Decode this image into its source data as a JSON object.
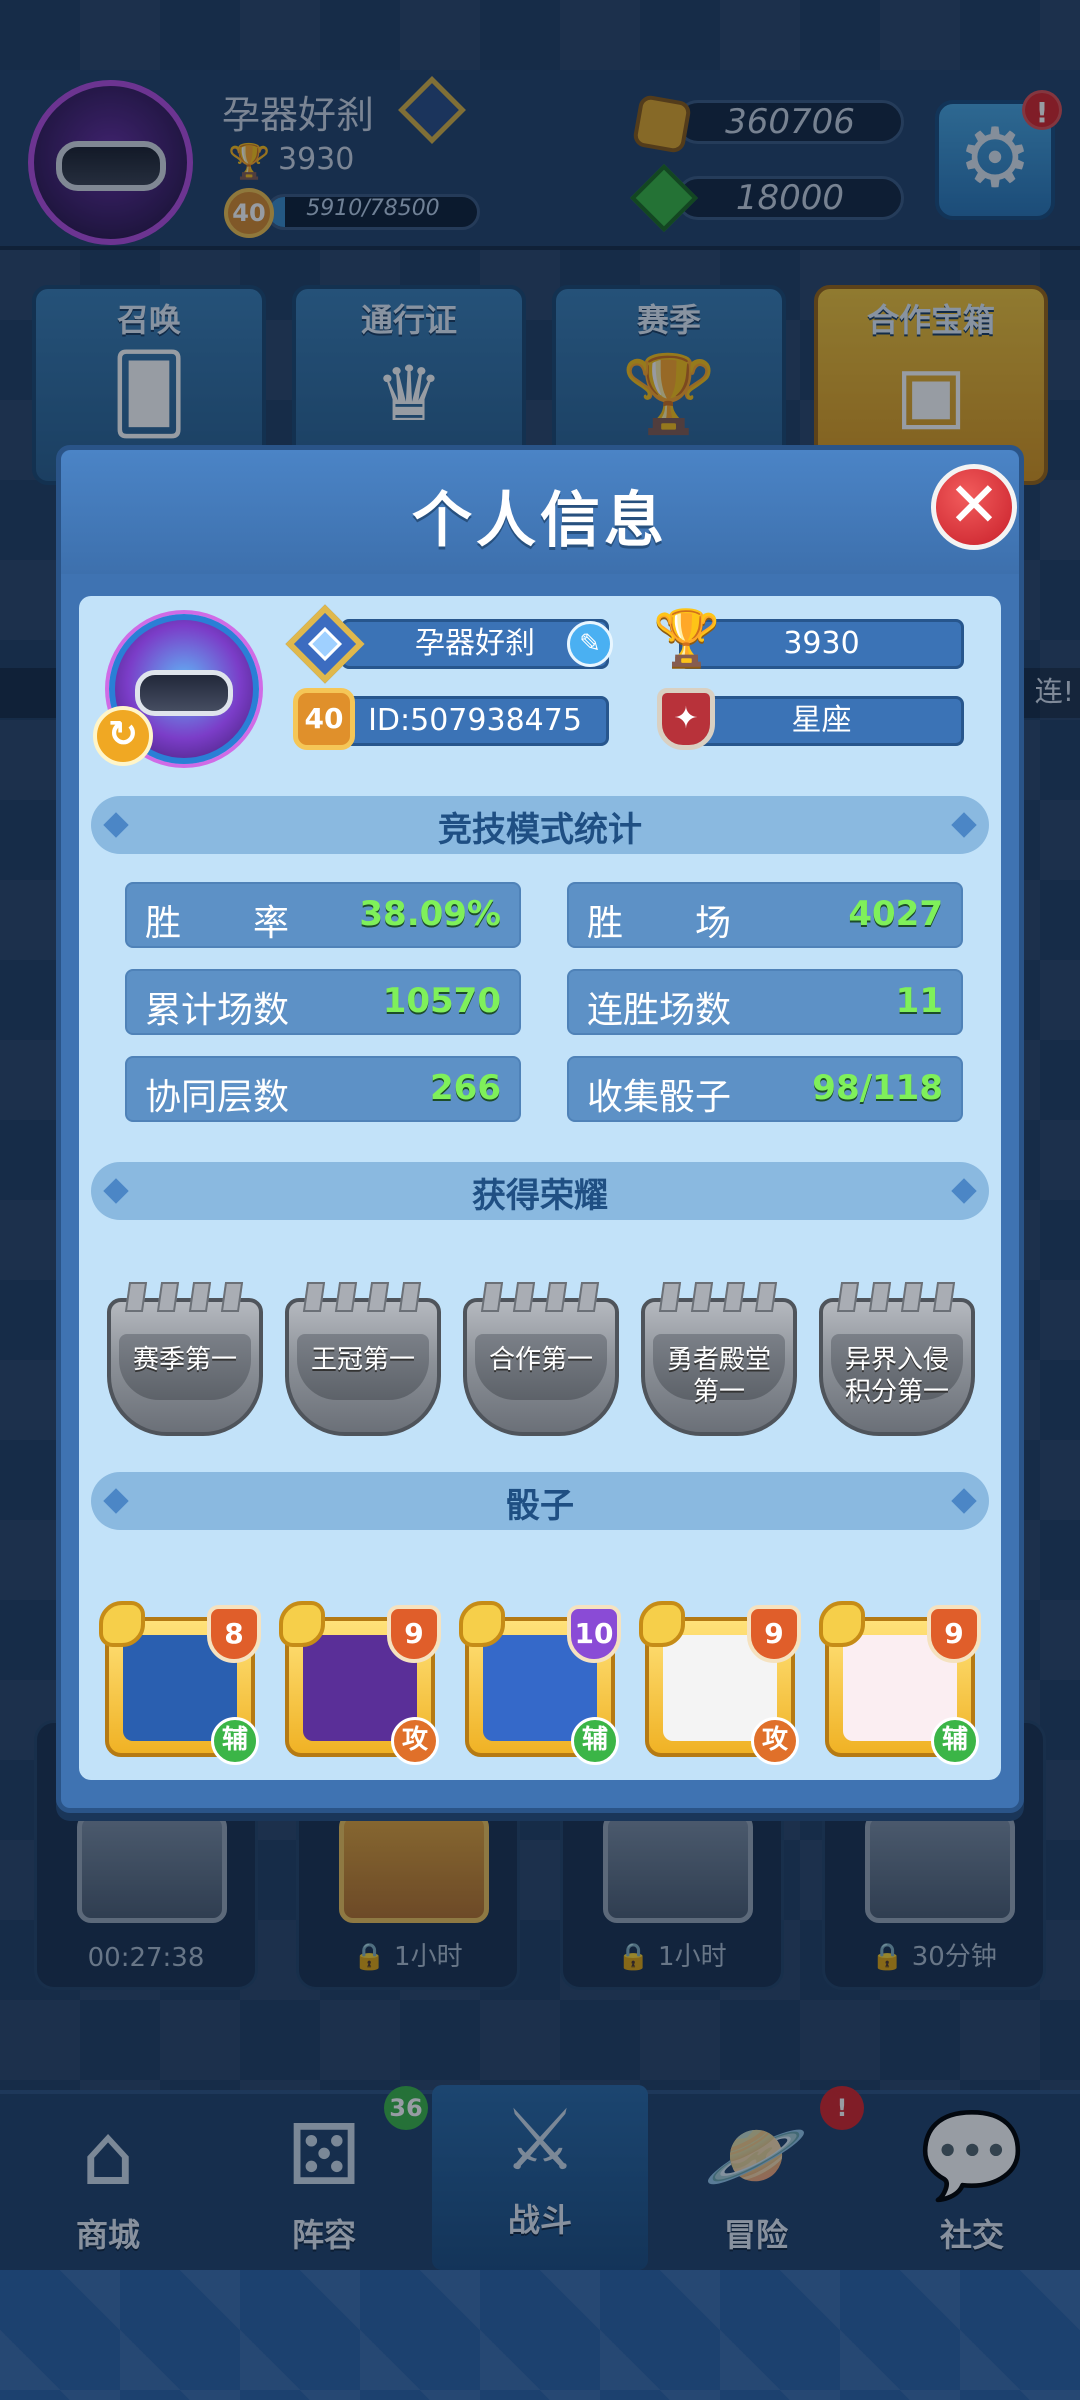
{
  "player": {
    "name": "孕器好刹",
    "trophies": "3930",
    "level": "40",
    "xp_text": "5910/78500",
    "xp_fraction": 0.075
  },
  "currency": {
    "gold": "360706",
    "gems": "18000"
  },
  "features": [
    {
      "label": "召唤"
    },
    {
      "label": "通行证"
    },
    {
      "label": "赛季"
    },
    {
      "label": "合作宝箱"
    }
  ],
  "ticker_text": "连!",
  "chests": [
    {
      "label": "00:27:38"
    },
    {
      "label": "1小时"
    },
    {
      "label": "1小时"
    },
    {
      "label": "30分钟"
    }
  ],
  "nav": [
    {
      "label": "商城",
      "icon": "shop-icon"
    },
    {
      "label": "阵容",
      "icon": "dice-icon",
      "badge": "36"
    },
    {
      "label": "战斗",
      "icon": "swords-icon"
    },
    {
      "label": "冒险",
      "icon": "planet-icon",
      "badge": "!"
    },
    {
      "label": "社交",
      "icon": "chat-icon"
    }
  ],
  "alert_badge": "!",
  "modal": {
    "title": "个人信息",
    "name": "孕器好刹",
    "trophies": "3930",
    "level": "40",
    "id_text": "ID:507938475",
    "clan": "星座",
    "stats_title": "竞技模式统计",
    "stats": [
      {
        "label": "胜　　率",
        "value": "38.09%"
      },
      {
        "label": "胜　　场",
        "value": "4027"
      },
      {
        "label": "累计场数",
        "value": "10570"
      },
      {
        "label": "连胜场数",
        "value": "11"
      },
      {
        "label": "协同层数",
        "value": "266"
      },
      {
        "label": "收集骰子",
        "value": "98/118"
      }
    ],
    "honors_title": "获得荣耀",
    "honors": [
      {
        "line1": "赛季第一",
        "line2": ""
      },
      {
        "line1": "王冠第一",
        "line2": ""
      },
      {
        "line1": "合作第一",
        "line2": ""
      },
      {
        "line1": "勇者殿堂",
        "line2": "第一"
      },
      {
        "line1": "异界入侵",
        "line2": "积分第一"
      }
    ],
    "dice_title": "骰子",
    "dice": [
      {
        "level": "8",
        "type": "辅",
        "color": "#2a5fb0"
      },
      {
        "level": "9",
        "type": "攻",
        "color": "#5a2f98"
      },
      {
        "level": "10",
        "type": "辅",
        "color": "#3569c9"
      },
      {
        "level": "9",
        "type": "攻",
        "color": "#f4f4f4"
      },
      {
        "level": "9",
        "type": "辅",
        "color": "#fbeef2"
      }
    ]
  },
  "colors": {
    "modal_bg": "#3f73b2",
    "panel_bg": "#c2e2f9",
    "stat_value": "#7ff05a",
    "section_bar": "#8ab9e0"
  }
}
